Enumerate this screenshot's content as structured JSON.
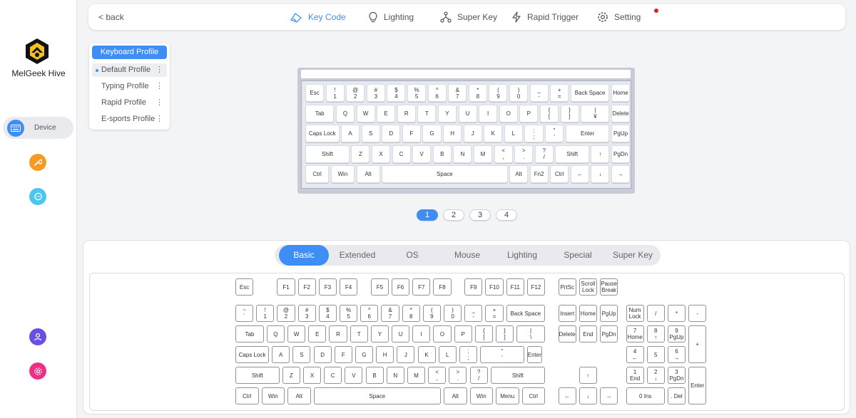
{
  "app": {
    "name": "MelGeek Hive"
  },
  "colors": {
    "accent": "#3f8ef5",
    "orange": "#f39b25",
    "cyan": "#4cc6ec",
    "purple": "#6a4fe0",
    "pink": "#ef2f85",
    "notif": "#e02020"
  },
  "sidebar": {
    "device_label": "Device",
    "icons": [
      "keyboard-icon",
      "wrench-icon",
      "chat-icon",
      "user-icon",
      "gear-icon"
    ]
  },
  "topbar": {
    "back": "< back",
    "tabs": [
      {
        "label": "Key Code",
        "icon": "key-code-icon",
        "active": true
      },
      {
        "label": "Lighting",
        "icon": "bulb-icon",
        "active": false
      },
      {
        "label": "Super Key",
        "icon": "super-key-icon",
        "active": false
      },
      {
        "label": "Rapid Trigger",
        "icon": "bolt-icon",
        "active": false
      },
      {
        "label": "Setting",
        "icon": "gear-icon",
        "active": false
      }
    ]
  },
  "profiles": {
    "title": "Keyboard Profile",
    "items": [
      {
        "name": "Default Profile",
        "selected": true
      },
      {
        "name": "Typing Profile",
        "selected": false
      },
      {
        "name": "Rapid Profile",
        "selected": false
      },
      {
        "name": "E-sports Profile",
        "selected": false
      }
    ],
    "more_glyph": "⋮"
  },
  "preview_keys": [
    [
      "Esc",
      "!\n1",
      "@\n2",
      "#\n3",
      "$\n4",
      "%\n5",
      "^\n6",
      "&\n7",
      "*\n8",
      "(\n9",
      ")\n0",
      "_\n-",
      "+\n=",
      "Back Space",
      "Home"
    ],
    [
      "Tab",
      "Q",
      "W",
      "E",
      "R",
      "T",
      "Y",
      "U",
      "I",
      "O",
      "P",
      "{\n[",
      "}\n]",
      "|\n¥",
      "Delete"
    ],
    [
      "Caps Lock",
      "A",
      "S",
      "D",
      "F",
      "G",
      "H",
      "J",
      "K",
      "L",
      ":\n;",
      "\"\n'",
      "Enter",
      "PgUp"
    ],
    [
      "Shift",
      "Z",
      "X",
      "C",
      "V",
      "B",
      "N",
      "M",
      "<\n,",
      ">\n.",
      "?\n/",
      "Shift",
      "↑",
      "PgDn"
    ],
    [
      "Ctrl",
      "Win",
      "Alt",
      "Space",
      "Alt",
      "Fn2",
      "Ctrl",
      "←",
      "↓",
      "→"
    ]
  ],
  "layers": [
    "1",
    "2",
    "3",
    "4"
  ],
  "active_layer": "1",
  "categories": [
    {
      "label": "Basic",
      "active": true
    },
    {
      "label": "Extended",
      "active": false
    },
    {
      "label": "OS",
      "active": false
    },
    {
      "label": "Mouse",
      "active": false
    },
    {
      "label": "Lighting",
      "active": false
    },
    {
      "label": "Special",
      "active": false
    },
    {
      "label": "Super Key",
      "active": false
    }
  ],
  "board_keys": {
    "fn_row": [
      "Esc",
      "F1",
      "F2",
      "F3",
      "F4",
      "F5",
      "F6",
      "F7",
      "F8",
      "F9",
      "F10",
      "F11",
      "F12",
      "PrtSc",
      "Scroll\nLock",
      "Pause\nBreak"
    ],
    "number_row": [
      "~\n`",
      "!\n1",
      "@\n2",
      "#\n3",
      "$\n4",
      "%\n5",
      "^\n6",
      "&\n7",
      "*\n8",
      "(\n9",
      ")\n0",
      "_\n-",
      "+\n=",
      "Back Space"
    ],
    "tab_row": [
      "Tab",
      "Q",
      "W",
      "E",
      "R",
      "T",
      "Y",
      "U",
      "I",
      "O",
      "P",
      "{\n[",
      "}\n]",
      "|\n\\"
    ],
    "caps_row": [
      "Caps Lock",
      "A",
      "S",
      "D",
      "F",
      "G",
      "H",
      "J",
      "K",
      "L",
      ":\n;",
      "\"\n'",
      "Enter"
    ],
    "shift_row": [
      "Shift",
      "Z",
      "X",
      "C",
      "V",
      "B",
      "N",
      "M",
      "<\n,",
      ">\n.",
      "?\n/",
      "Shift"
    ],
    "ctrl_row": [
      "Ctrl",
      "Win",
      "Alt",
      "Space",
      "Alt",
      "Win",
      "Menu",
      "Ctrl"
    ],
    "nav_row1": [
      "Insert",
      "Home",
      "PgUp"
    ],
    "nav_row2": [
      "Delete",
      "End",
      "PgDn"
    ],
    "arrows": [
      "↑",
      "←",
      "↓",
      "→"
    ],
    "numpad": [
      "Num\nLock",
      "/",
      "*",
      "-",
      "7\nHome",
      "8\n↑",
      "9\nPgUp",
      "+",
      "4\n←",
      "5",
      "6\n→",
      "1\nEnd",
      "2\n↓",
      "3\nPgDn",
      "Enter",
      "0 Ins",
      ". Del"
    ]
  }
}
